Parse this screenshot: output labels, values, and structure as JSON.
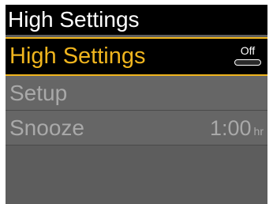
{
  "header": {
    "title": "High Settings"
  },
  "menu": {
    "high_settings": {
      "label": "High Settings",
      "toggle_state": "Off"
    },
    "setup": {
      "label": "Setup"
    },
    "snooze": {
      "label": "Snooze",
      "value": "1:00",
      "unit": "hr"
    }
  },
  "colors": {
    "accent": "#f0b51e",
    "title_background": "#000000",
    "disabled_text": "#a9a9a9",
    "panel_background": "#5d5d5d"
  }
}
